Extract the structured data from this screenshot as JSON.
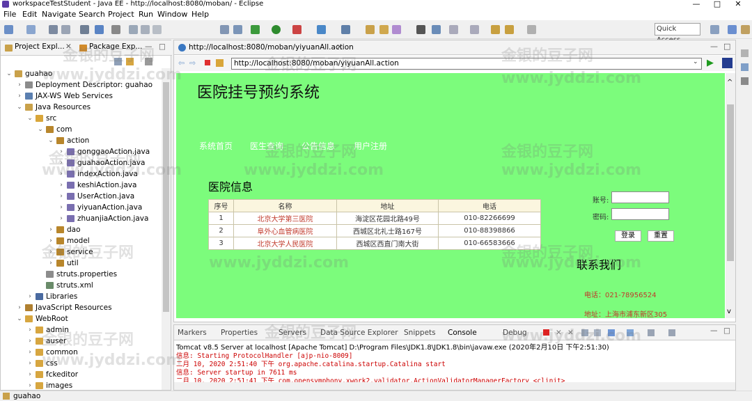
{
  "window": {
    "title": "workspaceTestStudent - Java EE - http://localhost:8080/moban/ - Eclipse"
  },
  "menu": [
    "File",
    "Edit",
    "Navigate",
    "Search",
    "Project",
    "Run",
    "Window",
    "Help"
  ],
  "toolbar": {
    "quick_access": "Quick Access"
  },
  "left": {
    "tab1": "Project Expl...",
    "tab2": "Package Exp...",
    "tree": [
      {
        "label": "guahao",
        "icon": "project-icon",
        "indent": 0,
        "arrow": "v"
      },
      {
        "label": "Deployment Descriptor: guahao",
        "icon": "descriptor-icon",
        "indent": 1,
        "arrow": ">"
      },
      {
        "label": "JAX-WS Web Services",
        "icon": "webservice-icon",
        "indent": 1,
        "arrow": ">"
      },
      {
        "label": "Java Resources",
        "icon": "java-resources-icon",
        "indent": 1,
        "arrow": "v"
      },
      {
        "label": "src",
        "icon": "source-folder-icon",
        "indent": 2,
        "arrow": "v"
      },
      {
        "label": "com",
        "icon": "package-icon",
        "indent": 3,
        "arrow": "v"
      },
      {
        "label": "action",
        "icon": "package-icon",
        "indent": 4,
        "arrow": "v"
      },
      {
        "label": "gonggaoAction.java",
        "icon": "java-file-icon",
        "indent": 5,
        "arrow": ">"
      },
      {
        "label": "guahaoAction.java",
        "icon": "java-file-icon",
        "indent": 5,
        "arrow": ">"
      },
      {
        "label": "indexAction.java",
        "icon": "java-file-icon",
        "indent": 5,
        "arrow": ">"
      },
      {
        "label": "keshiAction.java",
        "icon": "java-file-icon",
        "indent": 5,
        "arrow": ">"
      },
      {
        "label": "UserAction.java",
        "icon": "java-file-icon",
        "indent": 5,
        "arrow": ">"
      },
      {
        "label": "yiyuanAction.java",
        "icon": "java-file-icon",
        "indent": 5,
        "arrow": ">"
      },
      {
        "label": "zhuanjiaAction.java",
        "icon": "java-file-icon",
        "indent": 5,
        "arrow": ">"
      },
      {
        "label": "dao",
        "icon": "package-icon",
        "indent": 4,
        "arrow": ">"
      },
      {
        "label": "model",
        "icon": "package-icon",
        "indent": 4,
        "arrow": ">"
      },
      {
        "label": "service",
        "icon": "package-icon",
        "indent": 4,
        "arrow": ">"
      },
      {
        "label": "util",
        "icon": "package-icon",
        "indent": 4,
        "arrow": ">"
      },
      {
        "label": "struts.properties",
        "icon": "properties-file-icon",
        "indent": 3,
        "arrow": ""
      },
      {
        "label": "struts.xml",
        "icon": "xml-file-icon",
        "indent": 3,
        "arrow": ""
      },
      {
        "label": "Libraries",
        "icon": "library-icon",
        "indent": 2,
        "arrow": ">"
      },
      {
        "label": "JavaScript Resources",
        "icon": "js-resources-icon",
        "indent": 1,
        "arrow": ">"
      },
      {
        "label": "WebRoot",
        "icon": "folder-icon",
        "indent": 1,
        "arrow": "v"
      },
      {
        "label": "admin",
        "icon": "folder-icon",
        "indent": 2,
        "arrow": ">"
      },
      {
        "label": "auser",
        "icon": "folder-icon",
        "indent": 2,
        "arrow": ">"
      },
      {
        "label": "common",
        "icon": "folder-icon",
        "indent": 2,
        "arrow": ">"
      },
      {
        "label": "css",
        "icon": "folder-icon",
        "indent": 2,
        "arrow": ">"
      },
      {
        "label": "fckeditor",
        "icon": "folder-icon",
        "indent": 2,
        "arrow": ">"
      },
      {
        "label": "images",
        "icon": "folder-icon",
        "indent": 2,
        "arrow": ">"
      }
    ]
  },
  "editor": {
    "tab": "http://localhost:8080/moban/yiyuanAll.action",
    "url": "http://localhost:8080/moban/yiyuanAll.action"
  },
  "site": {
    "title": "医院挂号预约系统",
    "nav": [
      "系统首页",
      "医生查询",
      "公告信息",
      "用户注册"
    ],
    "section": "医院信息",
    "table_headers": [
      "序号",
      "名称",
      "地址",
      "电话"
    ],
    "table_rows": [
      [
        "1",
        "北京大学第三医院",
        "海淀区花园北路49号",
        "010-82266699"
      ],
      [
        "2",
        "阜外心血管病医院",
        "西城区北礼士路167号",
        "010-88398866"
      ],
      [
        "3",
        "北京大学人民医院",
        "西城区西直门南大街",
        "010-66583666"
      ]
    ],
    "login": {
      "account_label": "账号:",
      "password_label": "密码:",
      "login_btn": "登录",
      "reset_btn": "重置"
    },
    "contact": {
      "title": "联系我们",
      "phone": "电话：021-78956524",
      "address": "地址：上海市浦东新区305"
    }
  },
  "console": {
    "tabs": [
      "Markers",
      "Properties",
      "Servers",
      "Data Source Explorer",
      "Snippets",
      "Console",
      "Debug"
    ],
    "header": "Tomcat v8.5 Server at localhost [Apache Tomcat] D:\\Program Files\\JDK1.8\\JDK1.8\\bin\\javaw.exe (2020年2月10日 下午2:51:30)",
    "lines": [
      "信息: Starting ProtocolHandler [ajp-nio-8009]",
      "二月 10, 2020 2:51:40 下午 org.apache.catalina.startup.Catalina start",
      "信息: Server startup in 7611 ms",
      "二月 10, 2020 2:51:41 下午 com.opensymphony.xwork2.validator.ActionValidatorManagerFactory <clinit>"
    ]
  },
  "status": {
    "text": "guahao"
  },
  "watermark": {
    "cn": "金银的豆子网",
    "url": "www.jyddzi.com"
  }
}
